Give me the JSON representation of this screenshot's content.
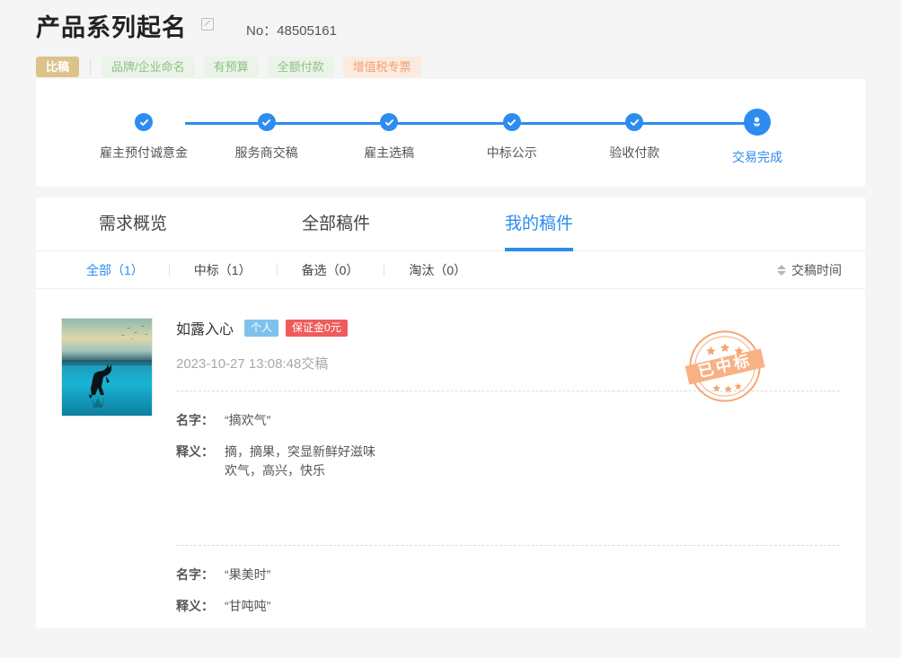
{
  "header": {
    "title": "产品系列起名",
    "edit_icon": "edit-square-icon",
    "order_no": "No：48505161",
    "tags": {
      "primary": "比稿",
      "green": [
        "品牌/企业命名",
        "有预算",
        "全额付款"
      ],
      "orange": "增值税专票"
    },
    "colors": {
      "primary_tag_bg": "#dbc389",
      "green_tag_bg": "#eaf4e8",
      "green_tag_text": "#8fbf85",
      "orange_tag_bg": "#fdeadf",
      "orange_tag_text": "#f0a070",
      "accent": "#2d8cf0"
    }
  },
  "stepper": {
    "steps": [
      {
        "label": "雇主预付诚意金",
        "icon": "check-icon",
        "state": "done"
      },
      {
        "label": "服务商交稿",
        "icon": "check-icon",
        "state": "done"
      },
      {
        "label": "雇主选稿",
        "icon": "check-icon",
        "state": "done"
      },
      {
        "label": "中标公示",
        "icon": "check-icon",
        "state": "done"
      },
      {
        "label": "验收付款",
        "icon": "check-icon",
        "state": "done"
      },
      {
        "label": "交易完成",
        "icon": "medal-icon",
        "state": "current"
      }
    ]
  },
  "tabs": [
    {
      "label": "需求概览",
      "active": false
    },
    {
      "label": "全部稿件",
      "active": false
    },
    {
      "label": "我的稿件",
      "active": true
    }
  ],
  "filters": {
    "items": [
      {
        "label": "全部（1）",
        "active": true
      },
      {
        "label": "中标（1）",
        "active": false
      },
      {
        "label": "备选（0）",
        "active": false
      },
      {
        "label": "淘汰（0）",
        "active": false
      }
    ],
    "sort": {
      "label": "交稿时间",
      "icon": "sort-arrows-icon"
    }
  },
  "submission": {
    "thumbnail_alt": "deer-silhouette-lake-artwork",
    "user": "如露入心",
    "badges": [
      {
        "label": "个人",
        "type": "blue"
      },
      {
        "label": "保证金0元",
        "type": "red"
      }
    ],
    "time": "2023-10-27 13:08:48交稿",
    "stamp": "已中标",
    "labels": {
      "name": "名字：",
      "meaning": "释义："
    },
    "entries": [
      {
        "name": "“摘欢气”",
        "meaning_line1": "摘，摘果，突显新鲜好滋味",
        "meaning_line2": "欢气，高兴，快乐"
      },
      {
        "name": "“果美时”",
        "meaning_line1": "“甘吨吨”",
        "meaning_line2": ""
      }
    ]
  }
}
